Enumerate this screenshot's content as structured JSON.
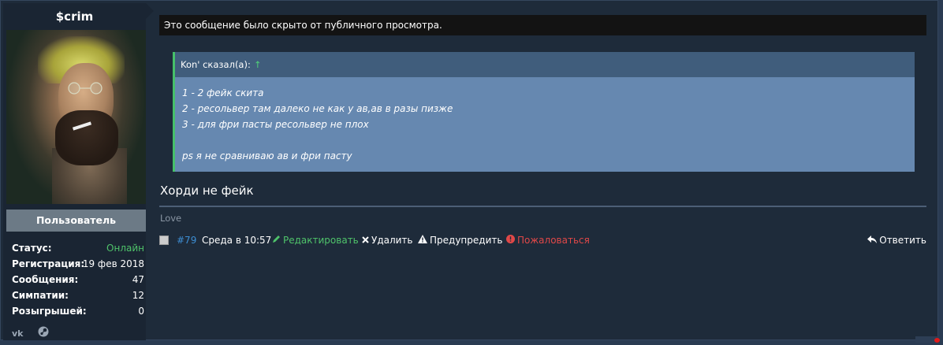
{
  "user": {
    "name": "$crim",
    "role": "Пользователь",
    "stats": [
      {
        "key": "Статус:",
        "value": "Онлайн",
        "highlight": true
      },
      {
        "key": "Регистрация:",
        "value": "19 фев 2018"
      },
      {
        "key": "Сообщения:",
        "value": "47"
      },
      {
        "key": "Симпатии:",
        "value": "12"
      },
      {
        "key": "Розыгрышей:",
        "value": "0"
      }
    ],
    "social_icons": [
      "vk-icon",
      "steam-icon"
    ]
  },
  "post": {
    "hidden_notice": "Это сообщение было скрыто от публичного просмотра.",
    "quote": {
      "author": "Kon' сказал(а):",
      "arrow": "↑",
      "lines": [
        "1 - 2 фейк скита",
        "2 - ресольвер там далеко не как у ав,ав в разы пизже",
        "3 - для фри пасты ресольвер не плох",
        "",
        "ps я не сравниваю ав и фри пасту"
      ]
    },
    "reply_text": "Хорди не фейк",
    "signature": "Love",
    "meta": {
      "number": "#79",
      "date": "Среда в 10:57"
    },
    "actions": {
      "edit": "Редактировать",
      "delete": "Удалить",
      "warn": "Предупредить",
      "report": "Пожаловаться",
      "reply": "Ответить"
    }
  },
  "colors": {
    "online": "#4fc36a",
    "edit": "#4fc36a",
    "report": "#e04848",
    "link": "#3d8ed3"
  }
}
